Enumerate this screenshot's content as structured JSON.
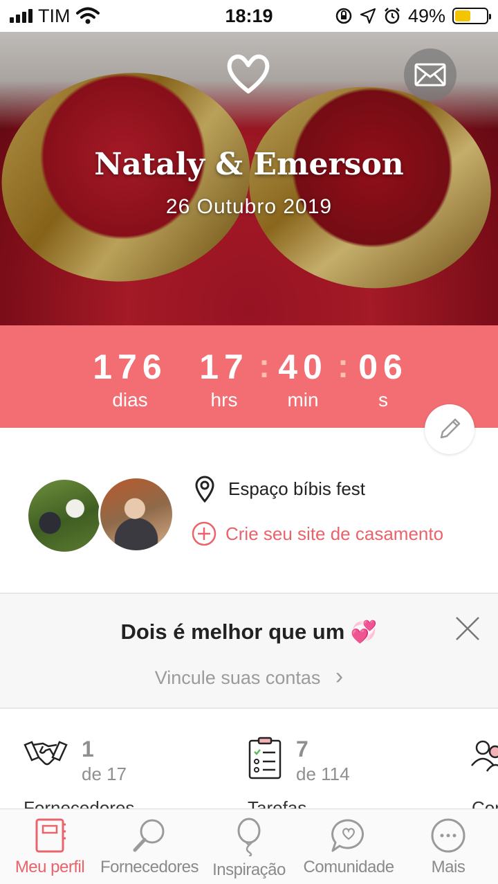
{
  "status_bar": {
    "carrier": "TIM",
    "time": "18:19",
    "battery": "49%",
    "battery_level": 0.49
  },
  "hero": {
    "couple_name": "Nataly & Emerson",
    "wedding_date": "26 Outubro 2019",
    "icons": [
      "heart-icon",
      "mail-icon"
    ]
  },
  "countdown": {
    "days": "176",
    "days_label": "dias",
    "hours": "17",
    "hours_label": "hrs",
    "minutes": "40",
    "minutes_label": "min",
    "seconds": "06",
    "seconds_label": "s",
    "separator": ":",
    "background": "#f26e73"
  },
  "profile": {
    "venue": "Espaço bíbis fest",
    "create_site": "Crie seu site de casamento"
  },
  "promo": {
    "title": "Dois é melhor que um 💞",
    "link": "Vincule suas contas",
    "chevron": "›"
  },
  "stats": [
    {
      "value": "1",
      "sub": "de 17",
      "caption": "Fornecedores",
      "icon": "handshake-icon"
    },
    {
      "value": "7",
      "sub": "de 114",
      "caption": "Tarefas",
      "icon": "checklist-icon"
    },
    {
      "value": "",
      "sub": "",
      "caption": "Convidados",
      "icon": "guests-icon"
    }
  ],
  "tabbar": {
    "tabs": [
      {
        "label": "Meu perfil",
        "icon": "notebook-icon",
        "active": true
      },
      {
        "label": "Fornecedores",
        "icon": "magnifier-icon",
        "active": false
      },
      {
        "label": "Inspiração",
        "icon": "balloon-icon",
        "active": false
      },
      {
        "label": "Comunidade",
        "icon": "chat-heart-icon",
        "active": false
      },
      {
        "label": "Mais",
        "icon": "more-icon",
        "active": false
      }
    ],
    "accent_color": "#e9636b"
  }
}
